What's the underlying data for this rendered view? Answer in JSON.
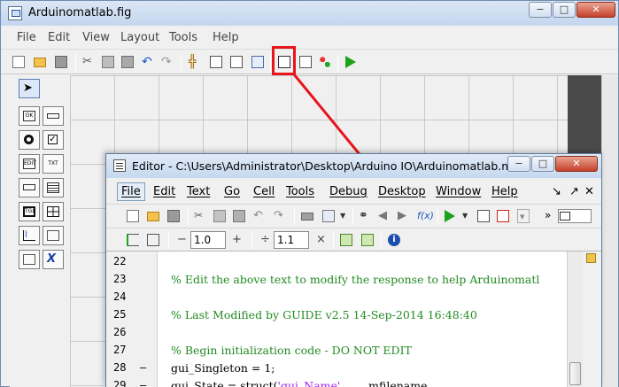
{
  "guide": {
    "title": "Arduinomatlab.fig",
    "window_buttons": [
      "−",
      "□",
      "✕"
    ],
    "menu": [
      "File",
      "Edit",
      "View",
      "Layout",
      "Tools",
      "Help"
    ]
  },
  "editor": {
    "title": "Editor - C:\\Users\\Administrator\\Desktop\\Arduino IO\\Arduinomatlab.m",
    "window_buttons": [
      "−",
      "□",
      "✕"
    ],
    "menu": [
      "File",
      "Edit",
      "Text",
      "Go",
      "Cell",
      "Tools",
      "Debug",
      "Desktop",
      "Window",
      "Help"
    ],
    "menu_right": [
      "↘",
      "↗",
      "✕"
    ],
    "toolbar2": {
      "minus": "−",
      "value1": "1.0",
      "plus": "+",
      "divide": "÷",
      "value2": "1.1",
      "times": "×"
    },
    "code_lines": [
      {
        "num": "22",
        "dash": "",
        "text": "",
        "cls": ""
      },
      {
        "num": "23",
        "dash": "",
        "text": "% Edit the above text to modify the response to help Arduinomatl",
        "cls": "cmt"
      },
      {
        "num": "24",
        "dash": "",
        "text": "",
        "cls": ""
      },
      {
        "num": "25",
        "dash": "",
        "text": "% Last Modified by GUIDE v2.5 14-Sep-2014 16:48:40",
        "cls": "cmt"
      },
      {
        "num": "26",
        "dash": "",
        "text": "",
        "cls": ""
      },
      {
        "num": "27",
        "dash": "",
        "text": "% Begin initialization code - DO NOT EDIT",
        "cls": "cmt"
      },
      {
        "num": "28",
        "dash": "–",
        "text": "gui_Singleton = 1;",
        "cls": ""
      },
      {
        "num": "29",
        "dash": "–",
        "text": "gui_State = struct('gui_Name',       mfilename, ...",
        "cls": "mixed"
      }
    ]
  },
  "colors": {
    "highlight": "#e8151b",
    "comment": "#228b22",
    "string": "#a020f0"
  }
}
